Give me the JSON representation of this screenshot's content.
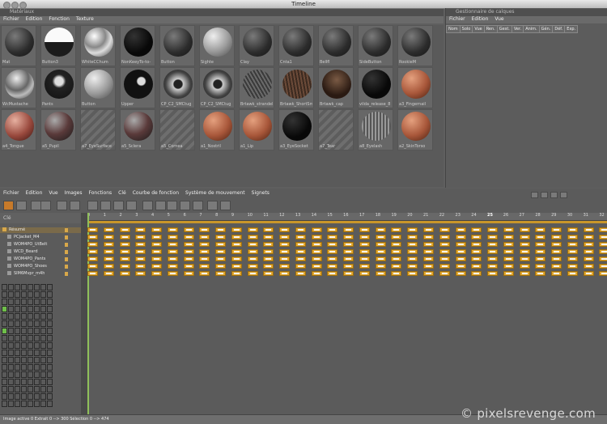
{
  "window": {
    "title": "Timeline"
  },
  "materials_panel": {
    "title": "Matériaux",
    "menu": [
      "Fichier",
      "Edition",
      "Fonction",
      "Texture"
    ],
    "rows": [
      [
        {
          "name": "Mat",
          "style": "dark"
        },
        {
          "name": "Button3",
          "style": "half"
        },
        {
          "name": "WhiteCChum",
          "style": "chrome"
        },
        {
          "name": "NonKeeyTo-to-",
          "style": "black"
        },
        {
          "name": "Button",
          "style": "dark"
        },
        {
          "name": "Sighte",
          "style": "light"
        },
        {
          "name": "Clay",
          "style": "dark"
        },
        {
          "name": "Cnta1",
          "style": "dark"
        },
        {
          "name": "Bellfl",
          "style": "dark"
        },
        {
          "name": "SideButton",
          "style": "dark"
        },
        {
          "name": "RookieM",
          "style": "dark"
        }
      ],
      [
        {
          "name": "WcMustache",
          "style": "chrome2"
        },
        {
          "name": "Pants",
          "style": "pin"
        },
        {
          "name": "Button",
          "style": "light"
        },
        {
          "name": "Upper",
          "style": "spots"
        },
        {
          "name": "CP_C2_SMCtug",
          "style": "eye"
        },
        {
          "name": "CP_C2_SMCtug",
          "style": "eye"
        },
        {
          "name": "Brtawk_strandell",
          "style": "hair"
        },
        {
          "name": "Brtawk_ShortSm",
          "style": "hairbrown"
        },
        {
          "name": "Brtawk_cap",
          "style": "hairpart"
        },
        {
          "name": "vilda_release_8",
          "style": "black"
        },
        {
          "name": "a3_Fingernail",
          "style": "skin"
        }
      ],
      [
        {
          "name": "a4_Tongue",
          "style": "tongue"
        },
        {
          "name": "a5_Pupil",
          "style": "pupil"
        },
        {
          "name": "a7_EyeSurface",
          "style": "empty"
        },
        {
          "name": "a5_Sclera",
          "style": "pupil"
        },
        {
          "name": "a5_Cornea",
          "style": "empty"
        },
        {
          "name": "a1_Nostril",
          "style": "skin"
        },
        {
          "name": "a1_Lip",
          "style": "skin"
        },
        {
          "name": "a3_EyeSocket",
          "style": "black"
        },
        {
          "name": "a7_Tear",
          "style": "empty"
        },
        {
          "name": "a8_Eyelash",
          "style": "lash"
        },
        {
          "name": "a2_SkinTorso",
          "style": "skin"
        }
      ]
    ]
  },
  "layers_panel": {
    "title": "Gestionnaire de calques",
    "menu": [
      "Fichier",
      "Edition",
      "Vue"
    ],
    "columns": [
      "Nom",
      "Solo",
      "Vue",
      "Ren.",
      "Gest.",
      "Ver.",
      "Anim.",
      "Gén.",
      "Déf.",
      "Exp."
    ]
  },
  "timeline_panel": {
    "menu": [
      "Fichier",
      "Edition",
      "Vue",
      "Images",
      "Fonctions",
      "Clé",
      "Courbe de fonction",
      "Système de mouvement",
      "Signets"
    ],
    "key_label": "Clé",
    "ruler": {
      "start": 0,
      "end": 32,
      "current": 25
    },
    "tracks": [
      "Résumé",
      "PCJacket_M4",
      "WOM4PO_UtBelt",
      "WCD_Beard",
      "WOM4PO_Pants",
      "WOM4PO_Shoes",
      "SIM6Mvpr_m4h"
    ],
    "key_frames": [
      0,
      1,
      2,
      3,
      4,
      5,
      6,
      7,
      8,
      9,
      10,
      11,
      12,
      13,
      14,
      15,
      16,
      17,
      18,
      19,
      20,
      21,
      22,
      23,
      24,
      25,
      26,
      27,
      28,
      29,
      30,
      31,
      32,
      33
    ]
  },
  "status_bar": {
    "text": "Image active  0   Extrait  0 --> 300   Sélection 0 --> 474"
  },
  "watermark": {
    "text": "© pixelsrevenge.com"
  },
  "colors": {
    "key": "#e2a72e",
    "accent": "#6a6a6a"
  }
}
